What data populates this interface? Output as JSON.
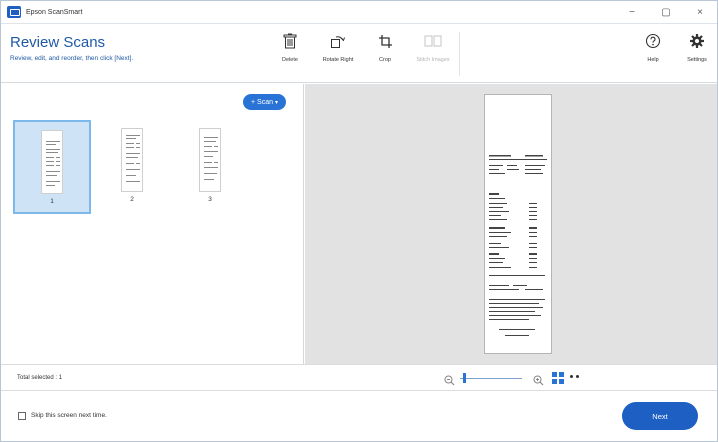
{
  "window": {
    "title": "Epson ScanSmart",
    "controls": {
      "minimize": "−",
      "maximize": "▢",
      "close": "×"
    }
  },
  "header": {
    "title": "Review Scans",
    "subtitle": "Review, edit, and reorder, then click [Next].",
    "tools": {
      "delete": "Delete",
      "rotate_right": "Rotate Right",
      "crop": "Crop",
      "stitch_images": "Stitch Images",
      "help": "Help",
      "settings": "Settings"
    }
  },
  "scan_button": {
    "label": "+ Scan",
    "caret": "▾"
  },
  "thumbnails": [
    {
      "number": "1",
      "selected": true
    },
    {
      "number": "2",
      "selected": false
    },
    {
      "number": "3",
      "selected": false
    }
  ],
  "status": {
    "total_selected": "Total selected : 1"
  },
  "zoom": {
    "level_fraction": 0.05
  },
  "footer": {
    "skip_label": "Skip this screen next time.",
    "skip_checked": false,
    "next_label": "Next"
  },
  "colors": {
    "accent": "#2a73d6",
    "title": "#1f5aa6",
    "next_button": "#1d5fc2",
    "selection_bg": "#cfe3f7",
    "preview_bg": "#e2e2e2"
  }
}
